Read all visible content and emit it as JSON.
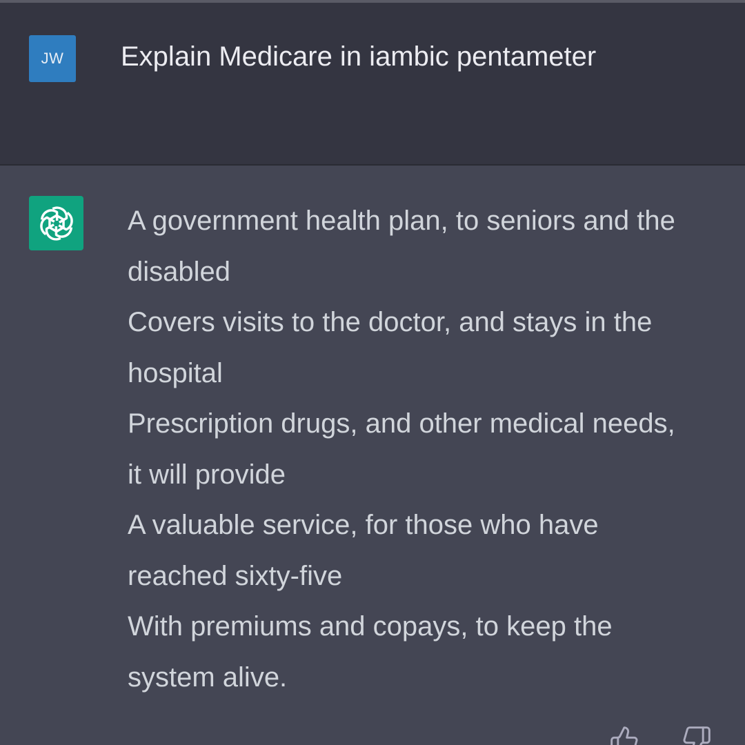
{
  "conversation": {
    "user_message": {
      "avatar_initials": "JW",
      "text": "Explain Medicare in iambic pentameter"
    },
    "assistant_message": {
      "avatar_icon": "openai-logo-icon",
      "lines": [
        "A government health plan, to seniors and the",
        "disabled",
        "Covers visits to the doctor, and stays in the",
        "hospital",
        "Prescription drugs, and other medical needs,",
        "it will provide",
        "A valuable service, for those who have",
        "reached sixty-five",
        "With premiums and copays, to keep the",
        "system alive."
      ]
    },
    "feedback": {
      "thumbs_up_icon": "thumbs-up-icon",
      "thumbs_down_icon": "thumbs-down-icon"
    }
  },
  "colors": {
    "user_background": "#343541",
    "assistant_background": "#444654",
    "user_avatar": "#2f7dbf",
    "assistant_avatar": "#10a37f",
    "text_primary": "#ececf1",
    "text_secondary": "#d1d5db"
  }
}
